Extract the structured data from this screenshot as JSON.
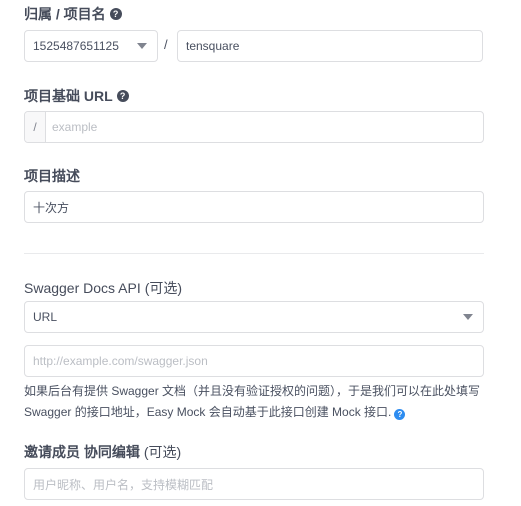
{
  "owner_project": {
    "label": "归属 / 项目名",
    "owner_value": "1525487651125",
    "separator": "/",
    "project_value": "tensquare"
  },
  "base_url": {
    "label": "项目基础 URL",
    "prefix": "/",
    "placeholder": "example"
  },
  "description": {
    "label": "项目描述",
    "value": "十次方"
  },
  "swagger": {
    "label": "Swagger Docs API",
    "optional": "(可选)",
    "select_value": "URL",
    "url_placeholder": "http://example.com/swagger.json",
    "hint": "如果后台有提供 Swagger 文档（并且没有验证授权的问题），于是我们可以在此处填写 Swagger 的接口地址，Easy Mock 会自动基于此接口创建 Mock 接口."
  },
  "members": {
    "label": "邀请成员 协同编辑",
    "optional": "(可选)",
    "placeholder": "用户昵称、用户名，支持模糊匹配"
  },
  "icons": {
    "help": "?",
    "info": "?"
  },
  "colors": {
    "text": "#495060",
    "border": "#dddee1",
    "placeholder": "#bbbec4",
    "info_blue": "#2d8cf0"
  }
}
